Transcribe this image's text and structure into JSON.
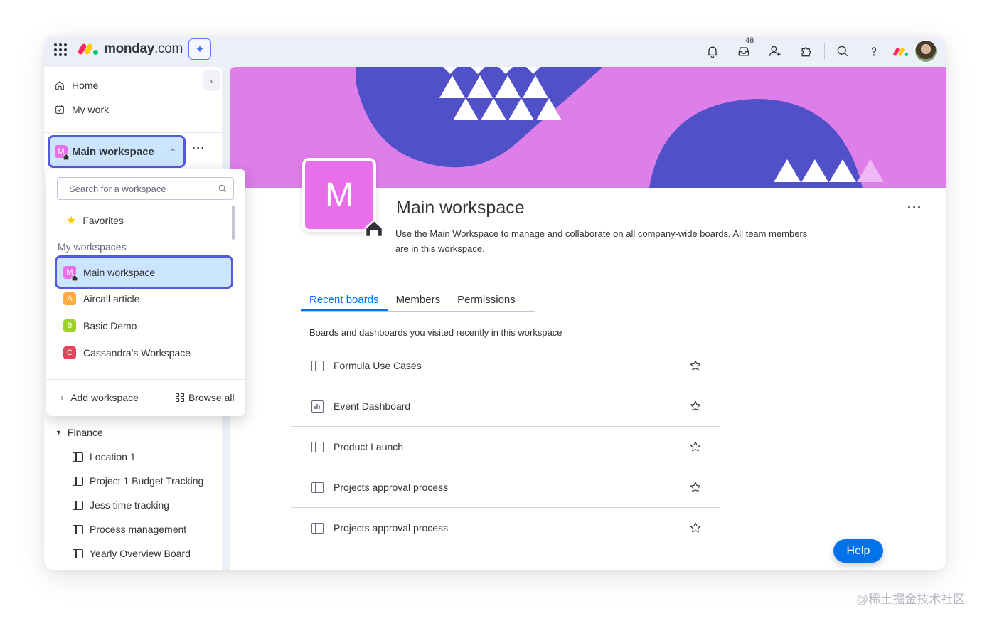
{
  "brand": {
    "name": "monday",
    "suffix": ".com",
    "colors": {
      "red": "#fb275d",
      "yellow": "#ffcc00",
      "green": "#00ca72"
    }
  },
  "topbar": {
    "inbox_count": "48",
    "icons": [
      "apps-grid-icon",
      "ai-sparkle-icon",
      "bell-icon",
      "inbox-icon",
      "invite-icon",
      "apps-icon",
      "search-icon",
      "help-icon"
    ]
  },
  "sidebar": {
    "home": "Home",
    "my_work": "My work",
    "workspace_switcher": {
      "label": "Main workspace",
      "badge": "M",
      "color": "#e86eea"
    },
    "folder": "Finance",
    "boards": [
      "Location 1",
      "Project 1 Budget Tracking",
      "Jess time tracking",
      "Process management",
      "Yearly Overview Board"
    ]
  },
  "dropdown": {
    "search_placeholder": "Search for a workspace",
    "favorites": "Favorites",
    "section_title": "My workspaces",
    "workspaces": [
      {
        "badge": "M",
        "name": "Main workspace",
        "color": "#e86eea",
        "selected": true
      },
      {
        "badge": "A",
        "name": "Aircall article",
        "color": "#fdab3d",
        "selected": false
      },
      {
        "badge": "B",
        "name": "Basic Demo",
        "color": "#9cd326",
        "selected": false
      },
      {
        "badge": "C",
        "name": "Cassandra's Workspace",
        "color": "#e2445c",
        "selected": false
      }
    ],
    "add_workspace": "Add workspace",
    "browse_all": "Browse all"
  },
  "main": {
    "avatar_letter": "M",
    "title": "Main workspace",
    "description": "Use the Main Workspace to manage and collaborate on all company-wide boards. All team members are in this workspace.",
    "tabs": [
      {
        "label": "Recent boards",
        "active": true
      },
      {
        "label": "Members",
        "active": false
      },
      {
        "label": "Permissions",
        "active": false
      }
    ],
    "recent_desc": "Boards and dashboards you visited recently in this workspace",
    "recent_boards": [
      {
        "name": "Formula Use Cases",
        "type": "board"
      },
      {
        "name": "Event Dashboard",
        "type": "dashboard"
      },
      {
        "name": "Product Launch",
        "type": "board"
      },
      {
        "name": "Projects approval process",
        "type": "board"
      },
      {
        "name": "Projects approval process",
        "type": "board"
      }
    ],
    "help": "Help",
    "cover_colors": {
      "background": "#de7ee8",
      "shape": "#5050c8"
    }
  },
  "watermark": "@稀土掘金技术社区"
}
